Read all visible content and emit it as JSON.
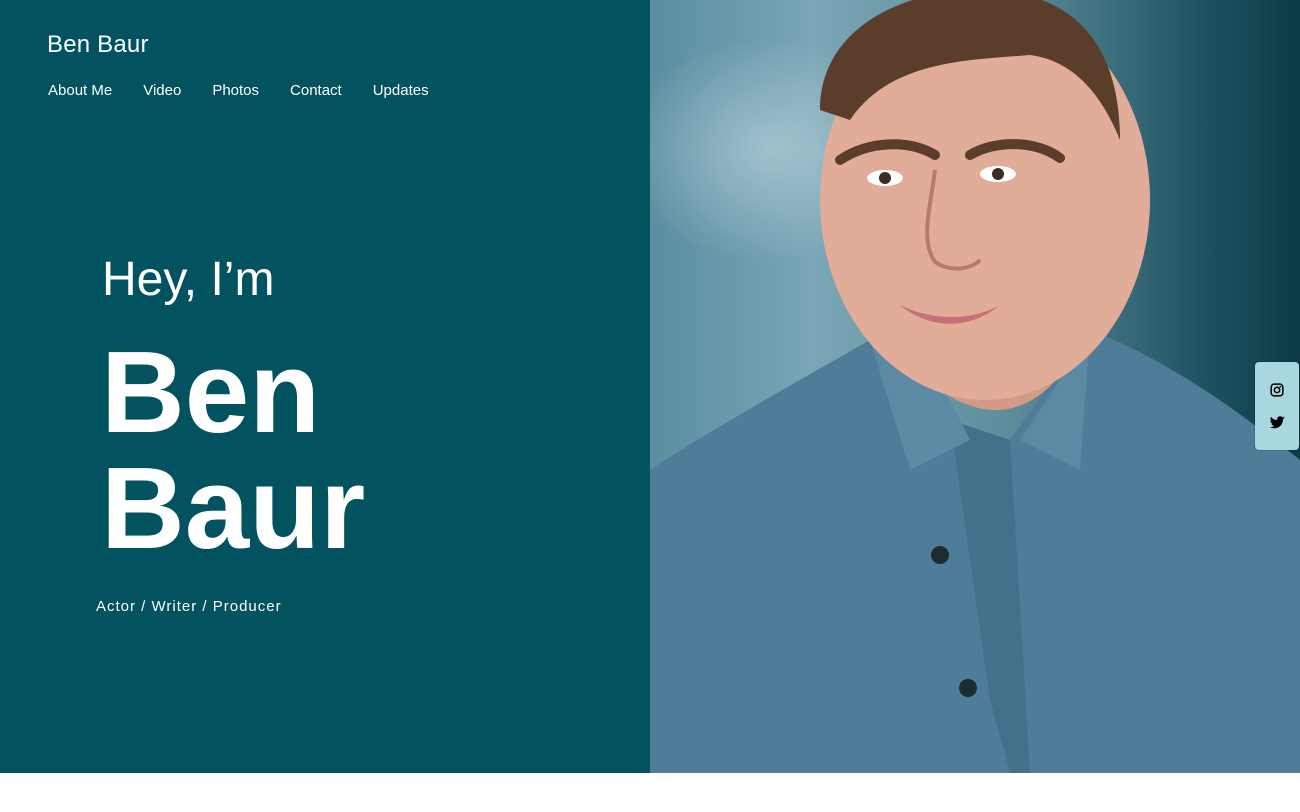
{
  "header": {
    "site_title": "Ben Baur",
    "nav": [
      "About Me",
      "Video",
      "Photos",
      "Contact",
      "Updates"
    ]
  },
  "hero": {
    "greeting": "Hey, I’m",
    "name_line1": "Ben",
    "name_line2": "Baur",
    "roles": "Actor / Writer / Producer"
  },
  "social": {
    "items": [
      {
        "icon": "instagram-icon"
      },
      {
        "icon": "twitter-icon"
      }
    ]
  },
  "colors": {
    "panel_background": "#02525f",
    "text": "#ffffff",
    "social_bar": "#a9d7df"
  }
}
